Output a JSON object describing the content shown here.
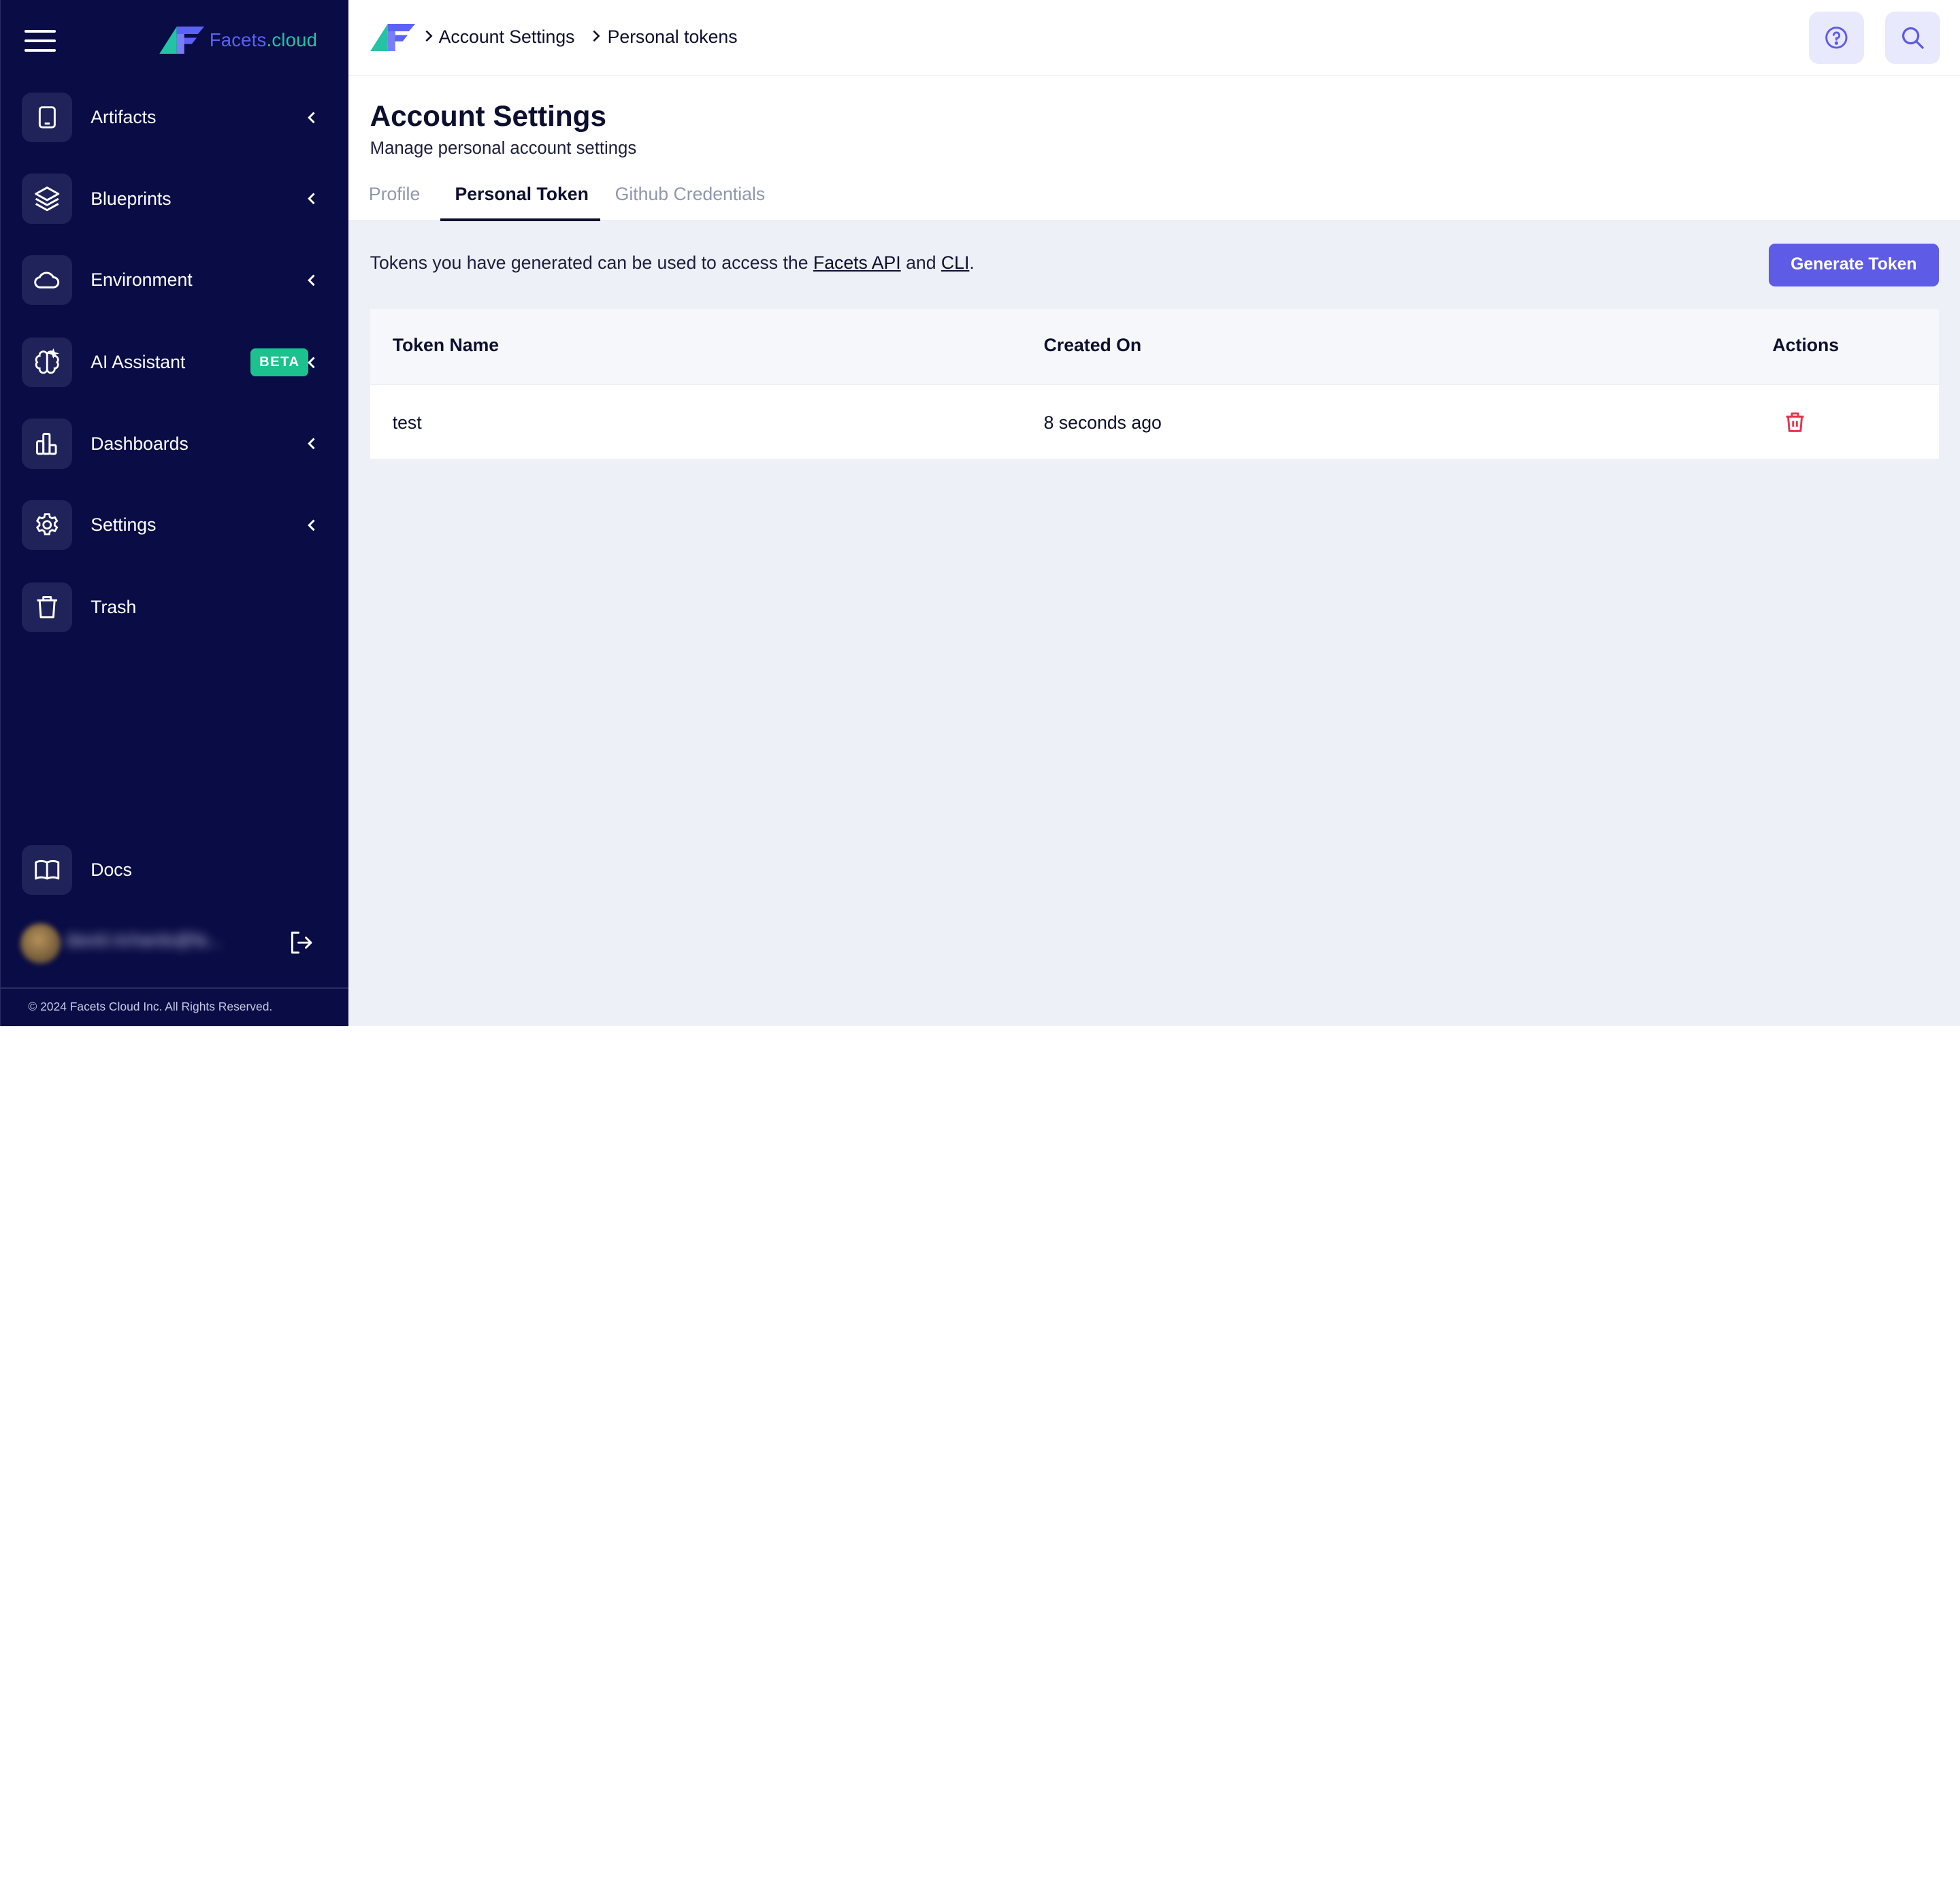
{
  "sidebar": {
    "logo_text_main": "Facets",
    "logo_text_dot": ".",
    "logo_text_suffix": "cloud",
    "items": [
      {
        "label": "Artifacts",
        "icon": "tablet-icon",
        "has_chevron": true
      },
      {
        "label": "Blueprints",
        "icon": "layers-icon",
        "has_chevron": true
      },
      {
        "label": "Environment",
        "icon": "cloud-icon",
        "has_chevron": true
      },
      {
        "label": "AI Assistant",
        "icon": "brain-icon",
        "has_chevron": true,
        "badge": "BETA"
      },
      {
        "label": "Dashboards",
        "icon": "bar-chart-icon",
        "has_chevron": true
      },
      {
        "label": "Settings",
        "icon": "gear-icon",
        "has_chevron": true
      },
      {
        "label": "Trash",
        "icon": "trash-icon",
        "has_chevron": false
      }
    ],
    "docs_label": "Docs",
    "username": "david.richards@fa...",
    "copyright": "© 2024 Facets Cloud Inc. All Rights Reserved."
  },
  "topbar": {
    "breadcrumb": [
      "Account Settings",
      "Personal tokens"
    ]
  },
  "header": {
    "title": "Account Settings",
    "subtitle": "Manage personal account settings",
    "tabs": [
      {
        "label": "Profile",
        "active": false
      },
      {
        "label": "Personal Token",
        "active": true
      },
      {
        "label": "Github Credentials",
        "active": false
      }
    ]
  },
  "content": {
    "info_prefix": "Tokens you have generated can be used to access the ",
    "info_link_api": "Facets API",
    "info_mid": " and ",
    "info_link_cli": "CLI",
    "info_suffix": ".",
    "generate_button": "Generate Token",
    "table": {
      "columns": [
        "Token Name",
        "Created On",
        "Actions"
      ],
      "rows": [
        {
          "token_name": "test",
          "created_on": "8 seconds ago"
        }
      ]
    }
  },
  "colors": {
    "sidebar_bg": "#0a0c45",
    "accent": "#5e5ce6",
    "beta_badge": "#1bc28e",
    "delete": "#e5354f"
  }
}
